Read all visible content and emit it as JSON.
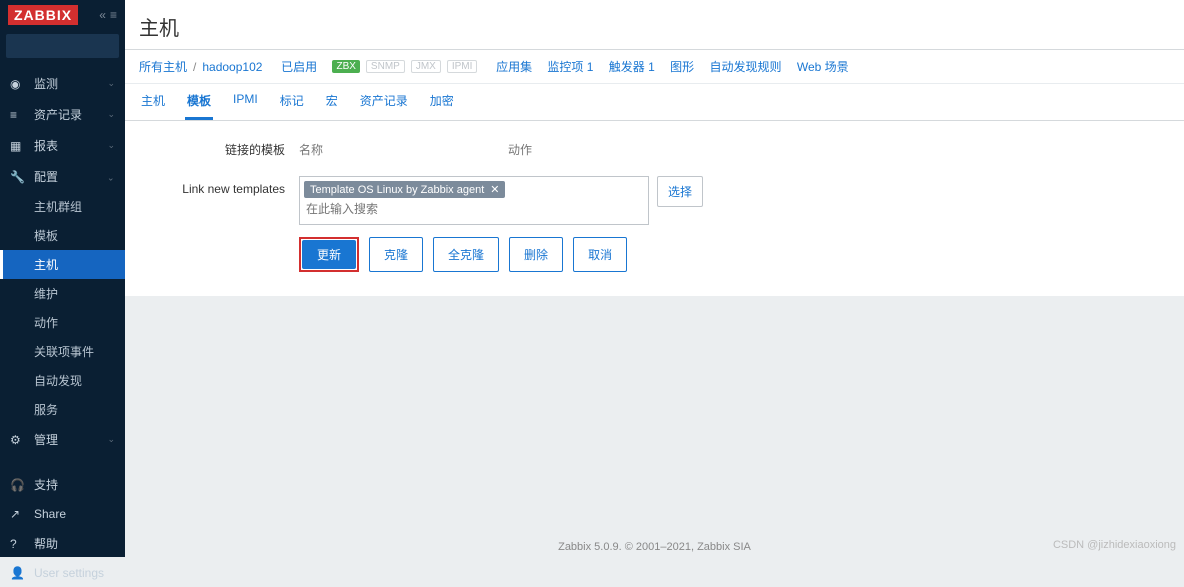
{
  "sidebar": {
    "logo": "ZABBIX",
    "collapse_glyph": "«",
    "menu_glyph": "≡",
    "search_placeholder": "",
    "groups": [
      {
        "icon": "◉",
        "label": "监测"
      },
      {
        "icon": "≡",
        "label": "资产记录"
      },
      {
        "icon": "▦",
        "label": "报表"
      },
      {
        "icon": "🔧",
        "label": "配置",
        "expanded": true,
        "items": [
          "主机群组",
          "模板",
          "主机",
          "维护",
          "动作",
          "关联项事件",
          "自动发现",
          "服务"
        ],
        "active": "主机"
      },
      {
        "icon": "⚙",
        "label": "管理"
      }
    ],
    "bottom": [
      {
        "icon": "🎧",
        "label": "支持"
      },
      {
        "icon": "↗",
        "label": "Share"
      },
      {
        "icon": "?",
        "label": "帮助"
      },
      {
        "icon": "👤",
        "label": "User settings"
      }
    ]
  },
  "page": {
    "title": "主机"
  },
  "hostbar": {
    "all_hosts": "所有主机",
    "hostname": "hadoop102",
    "enabled": "已启用",
    "zbx": "ZBX",
    "snmp": "SNMP",
    "jmx": "JMX",
    "ipmi": "IPMI",
    "links": [
      "应用集",
      "监控项 1",
      "触发器 1",
      "图形",
      "自动发现规则",
      "Web 场景"
    ]
  },
  "tabs": [
    "主机",
    "模板",
    "IPMI",
    "标记",
    "宏",
    "资产记录",
    "加密"
  ],
  "active_tab": "模板",
  "form": {
    "linked_label": "链接的模板",
    "col_name": "名称",
    "col_action": "动作",
    "link_new_label": "Link new templates",
    "tag_text": "Template OS Linux by Zabbix agent",
    "placeholder": "在此输入搜索",
    "select_btn": "选择"
  },
  "buttons": {
    "update": "更新",
    "clone": "克隆",
    "full_clone": "全克隆",
    "delete": "删除",
    "cancel": "取消"
  },
  "footer": "Zabbix 5.0.9. © 2001–2021, Zabbix SIA",
  "watermark": "CSDN @jizhidexiaoxiong"
}
